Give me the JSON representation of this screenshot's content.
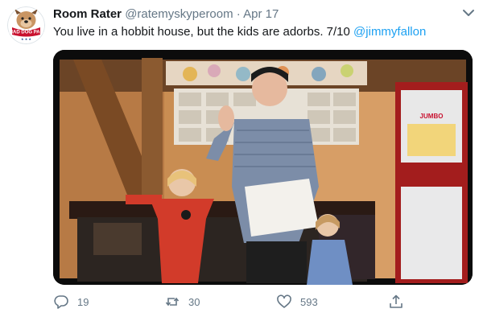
{
  "tweet": {
    "display_name": "Room Rater",
    "handle": "@ratemyskyperoom",
    "separator": "·",
    "date": "Apr 17",
    "text_main": "You live in a hobbit house, but the kids are adorbs. 7/10",
    "mention": "@jimmyfallon",
    "avatar": {
      "logo_text_top": "MAD DOG PAC",
      "logo_text_bottom": "★ ★ ★"
    },
    "media": {
      "board_text": "JUMBO"
    }
  },
  "actions": {
    "reply_count": "19",
    "retweet_count": "30",
    "like_count": "593"
  },
  "colors": {
    "accent": "#1da1f2",
    "muted": "#657786",
    "text": "#14171a"
  },
  "icons": {
    "menu": "chevron-down-icon",
    "reply": "reply-icon",
    "retweet": "retweet-icon",
    "like": "heart-icon",
    "share": "share-icon"
  }
}
